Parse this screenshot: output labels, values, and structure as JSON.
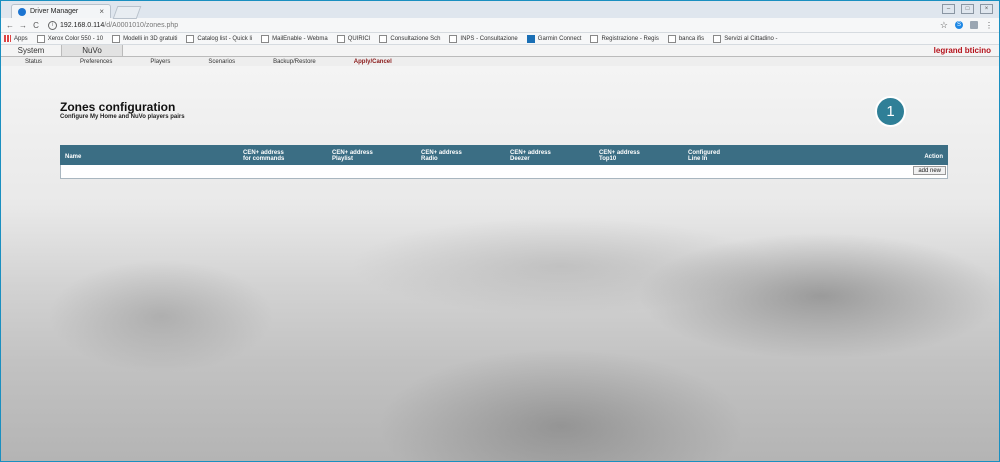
{
  "browser": {
    "tab_title": "Driver Manager",
    "url_host": "192.168.0.114",
    "url_path": "/d/A0001010/zones.php",
    "bookmarks": [
      "Apps",
      "Xerox Color 550 - 10",
      "Modelli in 3D gratuiti",
      "Catalog list - Quick li",
      "MailEnable - Webma",
      "QUIRICI",
      "Consultazione Sch",
      "INPS - Consultazione",
      "Garmin Connect",
      "Registrazione - Regis",
      "banca ifis",
      "Servizi al Cittadino -"
    ]
  },
  "app": {
    "main_tabs": [
      "System",
      "NuVo"
    ],
    "brand_legrand": "legrand",
    "brand_bticino": "bticino",
    "sub_nav": [
      "Status",
      "Preferences",
      "Players",
      "Scenarios",
      "Backup/Restore",
      "Apply/Cancel"
    ]
  },
  "page": {
    "title": "Zones configuration",
    "subtitle": "Configure My Home and NuVo players pairs"
  },
  "table": {
    "columns": [
      {
        "line1": "Name",
        "line2": ""
      },
      {
        "line1": "CEN+ address",
        "line2": "for commands"
      },
      {
        "line1": "CEN+ address",
        "line2": "Playlist"
      },
      {
        "line1": "CEN+ address",
        "line2": "Radio"
      },
      {
        "line1": "CEN+ address",
        "line2": "Deezer"
      },
      {
        "line1": "CEN+ address",
        "line2": "Top10"
      },
      {
        "line1": "Configured",
        "line2": "Line In"
      },
      {
        "line1": "Action",
        "line2": ""
      }
    ],
    "add_button_label": "add new"
  },
  "callout_number": "1",
  "colors": {
    "table_header": "#3b6e84",
    "callout": "#2f7f97",
    "brand_red": "#b5121b"
  }
}
